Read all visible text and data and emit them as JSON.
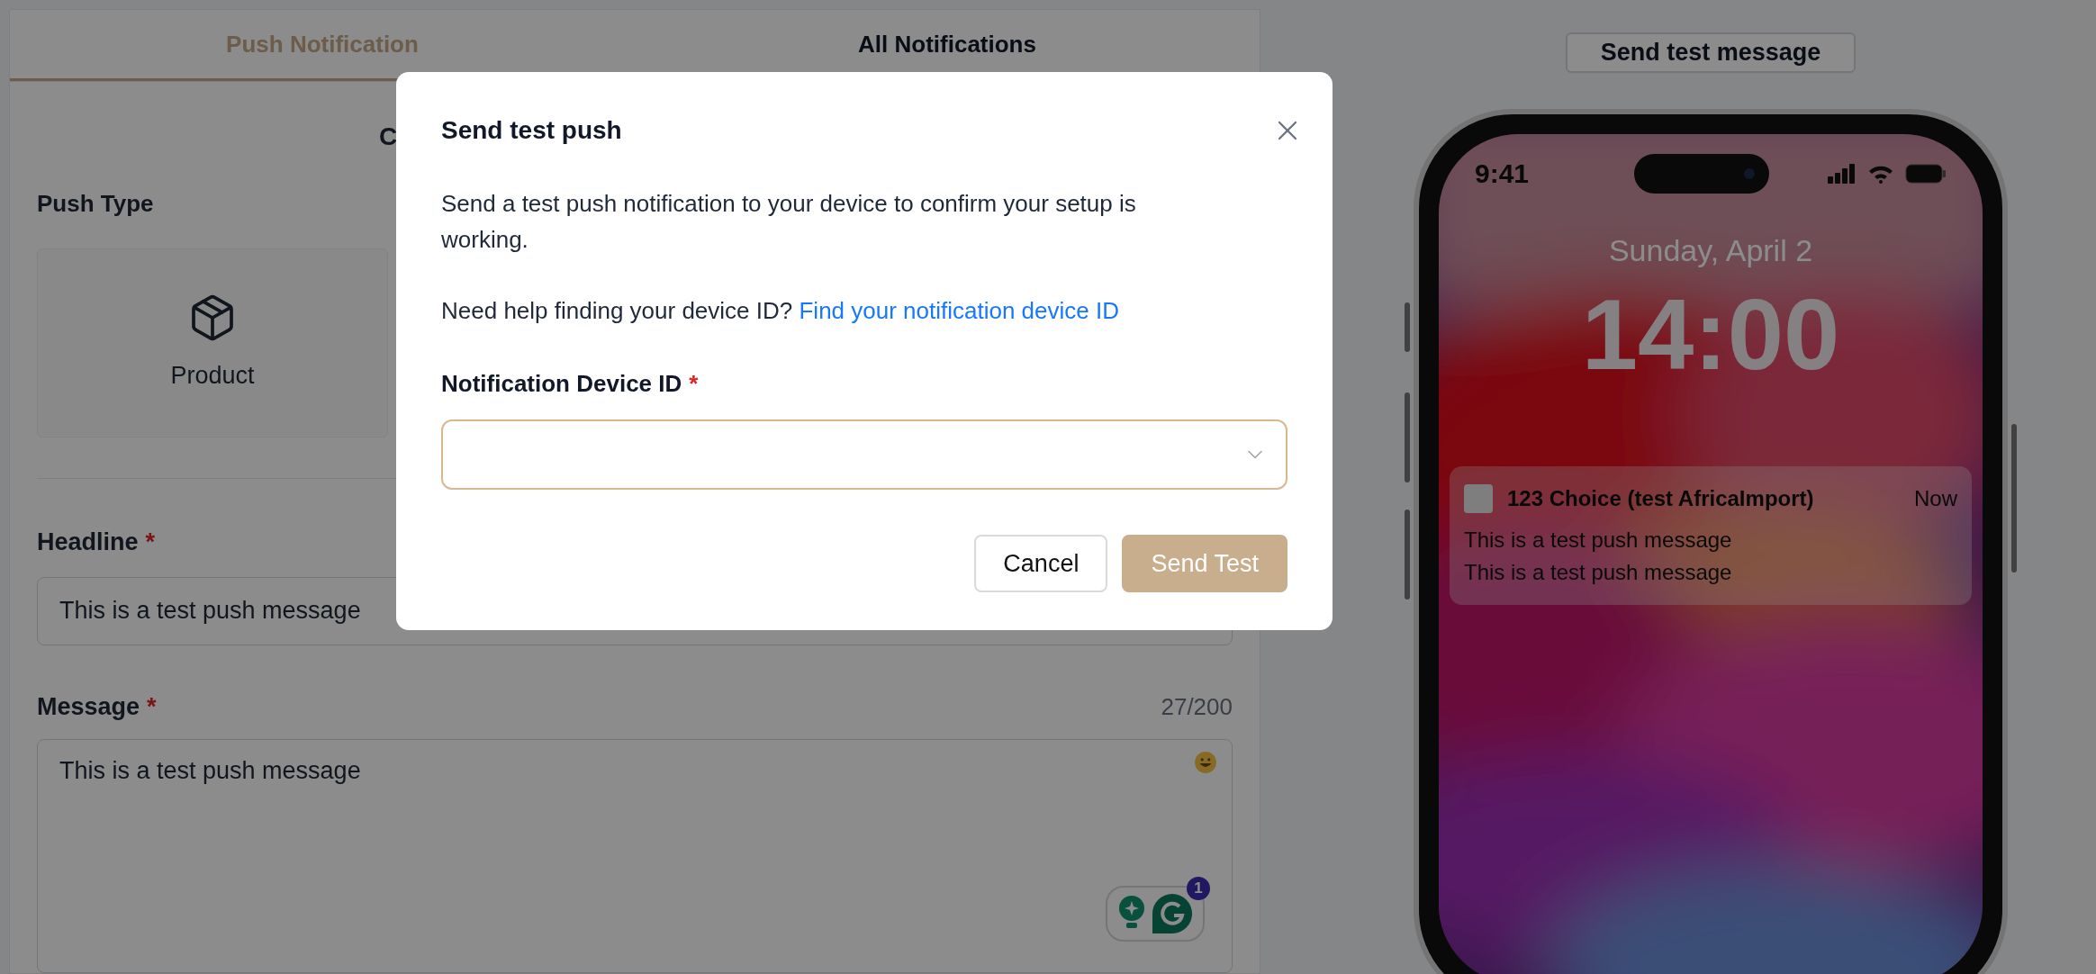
{
  "tabs": [
    {
      "label": "Push Notification",
      "selected": true
    },
    {
      "label": "All Notifications",
      "selected": false
    }
  ],
  "section_heading": "C",
  "push_type": {
    "label": "Push Type",
    "options": [
      {
        "label": "Product"
      }
    ]
  },
  "headline": {
    "label": "Headline",
    "required_mark": "*",
    "value": "This is a test push message"
  },
  "message": {
    "label": "Message",
    "required_mark": "*",
    "counter": "27/200",
    "value": "This is a test push message"
  },
  "grammarly_badge": "1",
  "send_test_message_button": "Send test message",
  "phone": {
    "time": "9:41",
    "date": "Sunday, April 2",
    "clock": "14:00",
    "notification": {
      "app": "123 Choice (test AfricaImport)",
      "time": "Now",
      "title": "This is a test push message",
      "body": "This is a test push message"
    }
  },
  "modal": {
    "title": "Send test push",
    "description": "Send a test push notification to your device to confirm your setup is working.",
    "help_text": "Need help finding your device ID?",
    "help_link": "Find your notification device ID",
    "field": {
      "label": "Notification Device ID",
      "required_mark": "*"
    },
    "buttons": [
      {
        "label": "Cancel",
        "kind": "secondary"
      },
      {
        "label": "Send Test",
        "kind": "primary"
      }
    ]
  }
}
